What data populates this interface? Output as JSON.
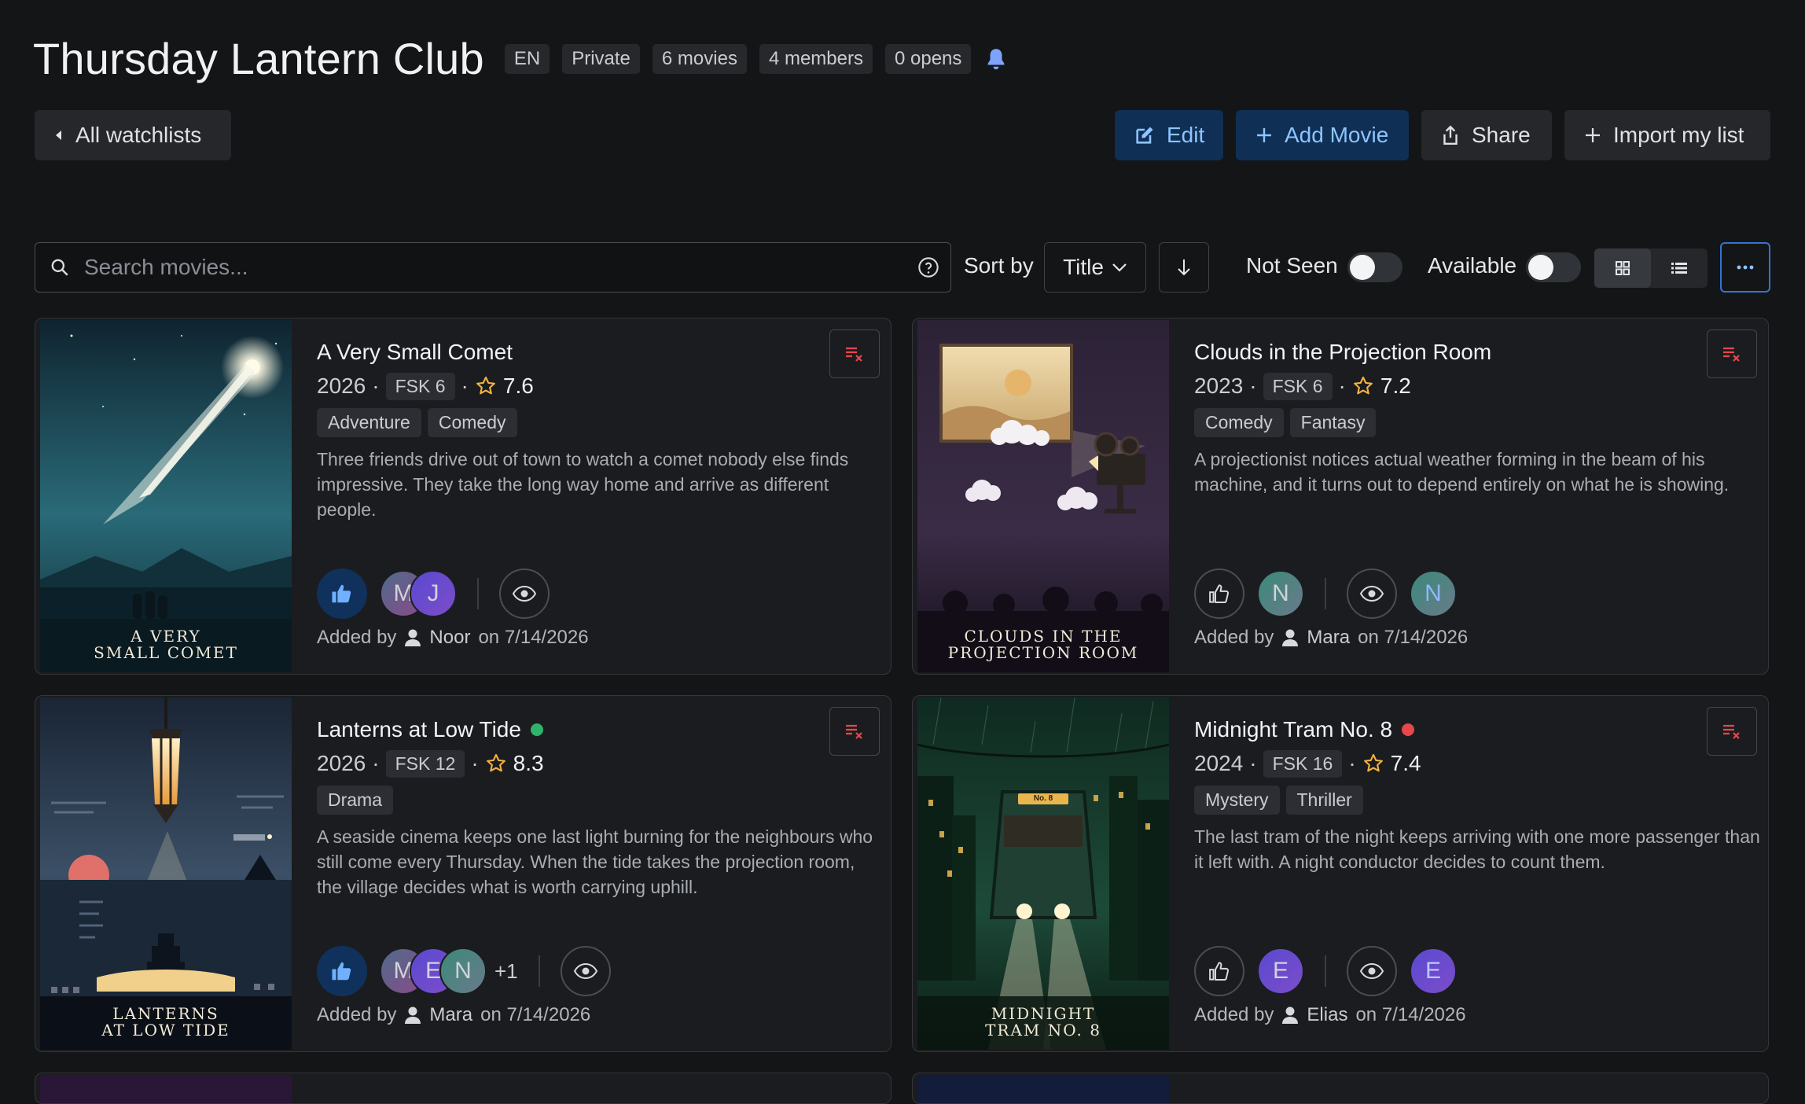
{
  "header": {
    "title": "Thursday Lantern Club",
    "chips": [
      "EN",
      "Private",
      "6 movies",
      "4 members",
      "0 opens"
    ],
    "bell_icon": "bell-icon",
    "accent": "#7ea3ff"
  },
  "nav": {
    "back_label": "All watchlists",
    "edit_label": "Edit",
    "add_label": "Add Movie",
    "share_label": "Share",
    "import_label": "Import my list"
  },
  "toolbar": {
    "search_placeholder": "Search movies...",
    "sort_label": "Sort by",
    "sort_value": "Title",
    "not_seen_label": "Not Seen",
    "available_label": "Available",
    "not_seen_on": false,
    "available_on": false,
    "view_mode": "grid"
  },
  "colors": {
    "green_dot": "#2fb36b",
    "red_dot": "#e5484d",
    "star": "#f5b342",
    "remove_icon": "#e5484d"
  },
  "movies": [
    {
      "title": "A Very Small Comet",
      "year": "2026",
      "fsk": "FSK 6",
      "rating": "7.6",
      "genres": [
        "Adventure",
        "Comedy"
      ],
      "description": "Three friends drive out of town to watch a comet nobody else finds impressive. They take the long way home and arrive as different people.",
      "poster_line1": "A VERY",
      "poster_line2": "SMALL COMET",
      "liked": true,
      "likers": [
        "M",
        "J"
      ],
      "watchers": [],
      "added_by_label": "Added by",
      "added_by": "Noor",
      "added_on": "on 7/14/2026"
    },
    {
      "title": "Clouds in the Projection Room",
      "year": "2023",
      "fsk": "FSK 6",
      "rating": "7.2",
      "genres": [
        "Comedy",
        "Fantasy"
      ],
      "description": "A projectionist notices actual weather forming in the beam of his machine, and it turns out to depend entirely on what he is showing.",
      "poster_line1": "CLOUDS IN THE",
      "poster_line2": "PROJECTION ROOM",
      "liked": false,
      "likers": [
        "N"
      ],
      "watchers": [
        "N"
      ],
      "added_by_label": "Added by",
      "added_by": "Mara",
      "added_on": "on 7/14/2026"
    },
    {
      "title": "Lanterns at Low Tide",
      "status": "available",
      "year": "2026",
      "fsk": "FSK 12",
      "rating": "8.3",
      "genres": [
        "Drama"
      ],
      "description": "A seaside cinema keeps one last light burning for the neighbours who still come every Thursday. When the tide takes the projection room, the village decides what is worth carrying uphill.",
      "poster_line1": "LANTERNS",
      "poster_line2": "AT LOW TIDE",
      "liked": true,
      "likers": [
        "M",
        "E",
        "N"
      ],
      "likers_more": "+1",
      "watchers": [],
      "added_by_label": "Added by",
      "added_by": "Mara",
      "added_on": "on 7/14/2026"
    },
    {
      "title": "Midnight Tram No. 8",
      "status": "unavailable",
      "year": "2024",
      "fsk": "FSK 16",
      "rating": "7.4",
      "genres": [
        "Mystery",
        "Thriller"
      ],
      "description": "The last tram of the night keeps arriving with one more passenger than it left with. A night conductor decides to count them.",
      "poster_line1": "MIDNIGHT",
      "poster_line2": "TRAM NO. 8",
      "poster_sign": "No. 8",
      "liked": false,
      "likers": [
        "E"
      ],
      "watchers": [
        "E"
      ],
      "added_by_label": "Added by",
      "added_by": "Elias",
      "added_on": "on 7/14/2026"
    }
  ]
}
